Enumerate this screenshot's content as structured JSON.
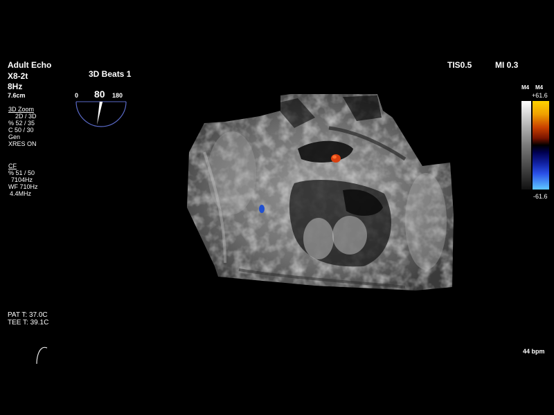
{
  "left_panel": {
    "preset": "Adult Echo",
    "probe": "X8-2t",
    "frame_rate": "8Hz",
    "depth": "7.6cm",
    "zoom_section": {
      "title": "3D Zoom",
      "lines": [
        "2D / 3D",
        "% 52 / 35",
        "C  50 / 30",
        "Gen",
        "XRES ON"
      ]
    },
    "cf_section": {
      "title": "CF",
      "lines": [
        "% 51 / 50",
        "7104Hz",
        "WF 710Hz",
        "4.4MHz"
      ]
    },
    "temperatures": {
      "patient": "PAT T: 37.0C",
      "tee": "TEE T: 39.1C"
    }
  },
  "beats_label": "3D Beats 1",
  "rotation": {
    "min": "0",
    "value": "80",
    "max": "180",
    "angle_degrees": 80
  },
  "top_right": {
    "tis": "TIS0.5",
    "mi": "MI 0.3"
  },
  "color_bar": {
    "label_1": "M4",
    "label_2": "M4",
    "max": "+61.6",
    "min": "-61.6",
    "colors": {
      "positive": [
        "#ffd200",
        "#f0a000",
        "#c84000",
        "#8a1800",
        "#4a0800"
      ],
      "negative": [
        "#000050",
        "#1020a0",
        "#2040e0",
        "#3a80f0",
        "#60c8ff"
      ]
    }
  },
  "heart_rate": "44 bpm",
  "volume_render": {
    "color_flow_red": "#d84010",
    "color_flow_blue": "#2050d0",
    "tissue_colors": [
      "#2a2a2a",
      "#555555",
      "#8a8a8a",
      "#b5b5b5",
      "#d8d8d8"
    ]
  }
}
